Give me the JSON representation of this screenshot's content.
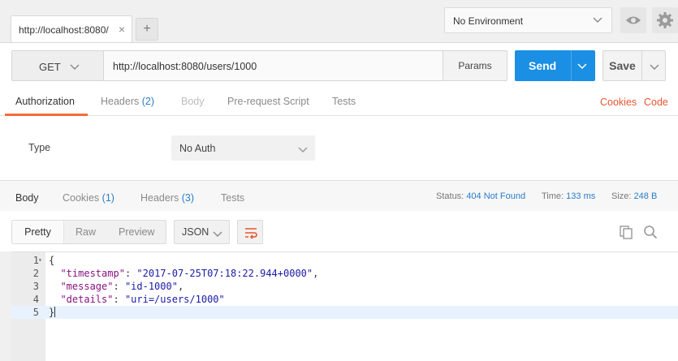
{
  "tabs": [
    {
      "label": "http://localhost:8080/"
    }
  ],
  "environment": {
    "selected": "No Environment"
  },
  "request": {
    "method": "GET",
    "url": "http://localhost:8080/users/1000",
    "params_label": "Params",
    "send_label": "Send",
    "save_label": "Save"
  },
  "request_tabs": [
    {
      "label": "Authorization",
      "count": ""
    },
    {
      "label": "Headers",
      "count": "(2)"
    },
    {
      "label": "Body",
      "count": ""
    },
    {
      "label": "Pre-request Script",
      "count": ""
    },
    {
      "label": "Tests",
      "count": ""
    }
  ],
  "request_links": {
    "cookies": "Cookies",
    "code": "Code"
  },
  "auth": {
    "type_label": "Type",
    "selected": "No Auth"
  },
  "response_tabs": [
    {
      "label": "Body",
      "count": ""
    },
    {
      "label": "Cookies",
      "count": "(1)"
    },
    {
      "label": "Headers",
      "count": "(3)"
    },
    {
      "label": "Tests",
      "count": ""
    }
  ],
  "response_meta": {
    "status_label": "Status:",
    "status_value": "404 Not Found",
    "time_label": "Time:",
    "time_value": "133 ms",
    "size_label": "Size:",
    "size_value": "248 B"
  },
  "view_modes": {
    "pretty": "Pretty",
    "raw": "Raw",
    "preview": "Preview",
    "format": "JSON"
  },
  "response_body": {
    "line_numbers": [
      "1",
      "2",
      "3",
      "4",
      "5"
    ],
    "open_brace": "{",
    "close_brace": "}",
    "fields": [
      {
        "key": "\"timestamp\"",
        "value": "\"2017-07-25T07:18:22.944+0000\"",
        "trail": ","
      },
      {
        "key": "\"message\"",
        "value": "\"id-1000\"",
        "trail": ","
      },
      {
        "key": "\"details\"",
        "value": "\"uri=/users/1000\"",
        "trail": ""
      }
    ]
  },
  "colors": {
    "accent": "#f26b3a",
    "send": "#1a8fe3",
    "link": "#2a7cc7"
  },
  "icons": [
    "close-icon",
    "plus-icon",
    "chevron-down-icon",
    "eye-icon",
    "gear-icon",
    "wrap-icon",
    "copy-icon",
    "search-icon"
  ]
}
